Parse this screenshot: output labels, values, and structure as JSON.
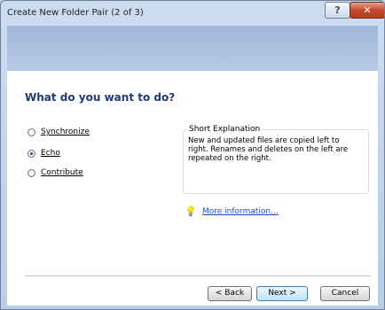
{
  "window": {
    "title": "Create New Folder Pair (2 of 3)",
    "help_label": "?",
    "close_label": "✕"
  },
  "page": {
    "heading": "What do you want to do?"
  },
  "options": [
    {
      "label": "Synchronize",
      "checked": false
    },
    {
      "label": "Echo",
      "checked": true
    },
    {
      "label": "Contribute",
      "checked": false
    }
  ],
  "explanation": {
    "title": "Short Explanation",
    "lines": [
      "New and updated files are copied left to",
      "right. Renames and deletes on the left are",
      "repeated on the right."
    ]
  },
  "link": {
    "icon": "lightbulb-icon",
    "label": "More information..."
  },
  "buttons": {
    "back": "< Back",
    "next": "Next >",
    "cancel": "Cancel"
  },
  "colors": {
    "heading": "#1f3a7a",
    "link": "#1a4fb5",
    "close": "#c4482c"
  }
}
